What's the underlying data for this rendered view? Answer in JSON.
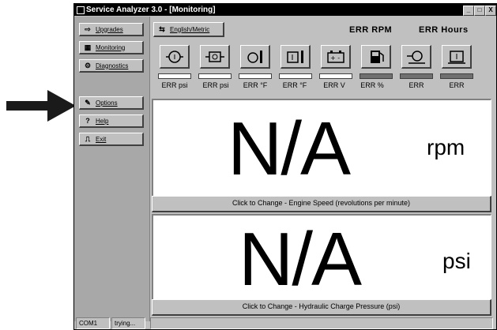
{
  "window": {
    "title": "Service Analyzer 3.0 - [Monitoring]",
    "controls": [
      "_",
      "□",
      "X"
    ]
  },
  "sidebar": {
    "items": [
      {
        "label": "Upgrades",
        "icon": "upgrade-icon"
      },
      {
        "label": "Monitoring",
        "icon": "monitoring-icon"
      },
      {
        "label": "Diagnostics",
        "icon": "diagnostics-icon"
      },
      {
        "label": "Options",
        "icon": "options-icon"
      },
      {
        "label": "Help",
        "icon": "help-icon"
      },
      {
        "label": "Exit",
        "icon": "exit-icon"
      }
    ]
  },
  "header": {
    "units_button": "English/Metric",
    "rpm_readout": "ERR RPM",
    "hours_readout": "ERR Hours"
  },
  "gauges": [
    {
      "label": "ERR psi",
      "icon": "engine-oil-pressure-icon",
      "bar": "light"
    },
    {
      "label": "ERR psi",
      "icon": "hydraulic-pressure-icon",
      "bar": "light"
    },
    {
      "label": "ERR °F",
      "icon": "engine-temp-icon",
      "bar": "light"
    },
    {
      "label": "ERR °F",
      "icon": "hydraulic-temp-icon",
      "bar": "light"
    },
    {
      "label": "ERR V",
      "icon": "battery-icon",
      "bar": "light"
    },
    {
      "label": "ERR %",
      "icon": "fuel-icon",
      "bar": "dark"
    },
    {
      "label": "ERR",
      "icon": "filter-icon",
      "bar": "dark"
    },
    {
      "label": "ERR",
      "icon": "reservoir-icon",
      "bar": "dark"
    }
  ],
  "panels": [
    {
      "value": "N/A",
      "unit": "rpm",
      "change_label": "Click to Change - Engine Speed (revolutions per minute)"
    },
    {
      "value": "N/A",
      "unit": "psi",
      "change_label": "Click to Change - Hydraulic Charge Pressure (psi)"
    }
  ],
  "statusbar": {
    "port": "COM1",
    "state": "trying..."
  },
  "annotation": {
    "arrow": "pointer-arrow"
  }
}
